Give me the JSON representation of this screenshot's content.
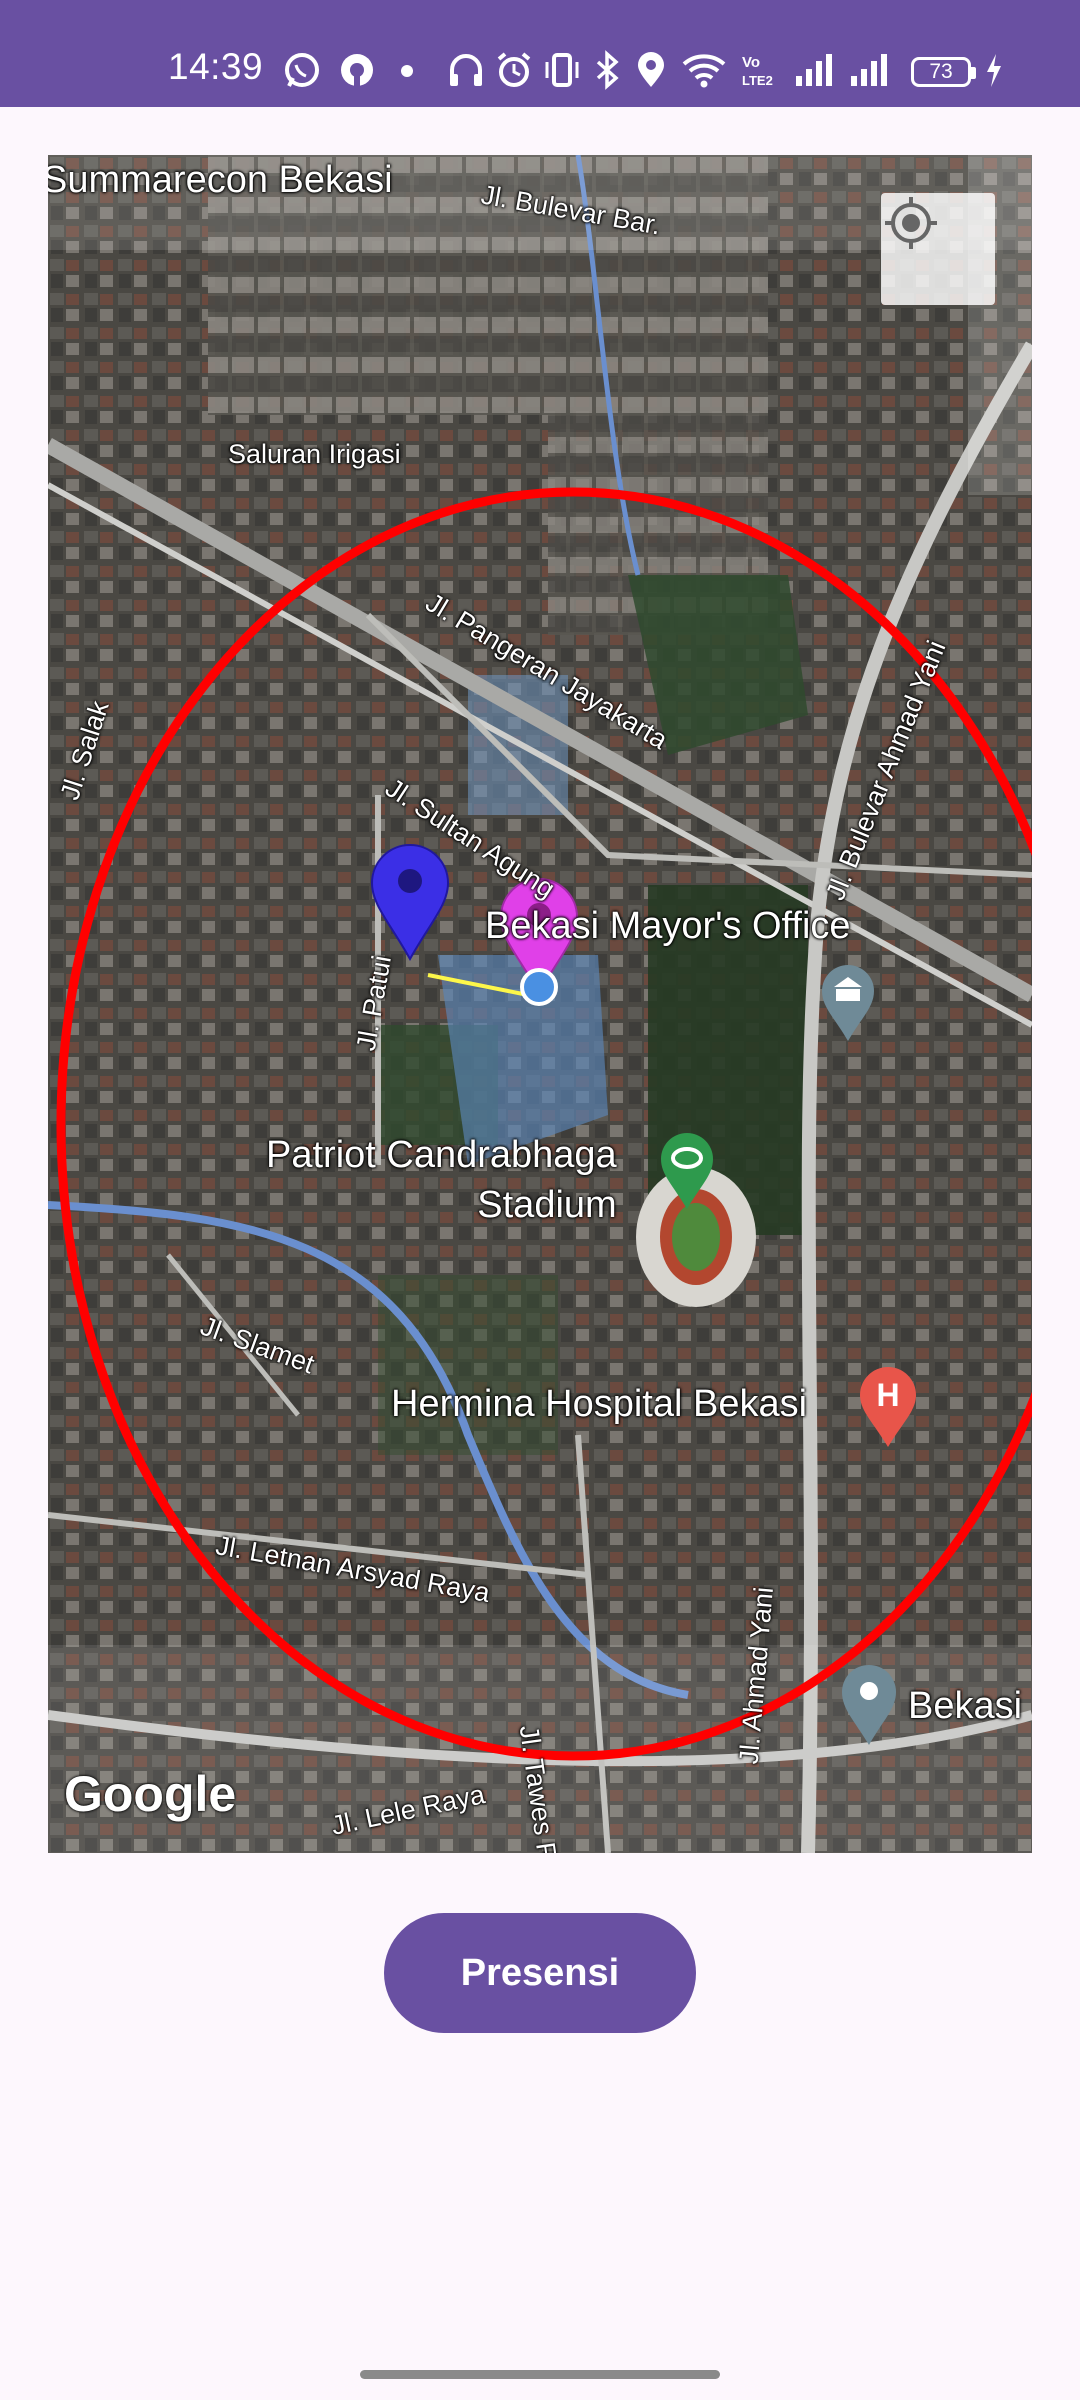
{
  "status_bar": {
    "time": "14:39",
    "battery": "73",
    "icons": [
      "whatsapp-icon",
      "app-icon",
      "dot-icon",
      "headphones-icon",
      "alarm-icon",
      "vibrate-icon",
      "bluetooth-icon",
      "location-icon",
      "wifi-icon",
      "volte-icon",
      "signal-icon",
      "signal-icon",
      "battery-icon",
      "charging-icon"
    ],
    "volte_text": "Vo\nLTE2"
  },
  "map": {
    "labels": {
      "summarecon": "Summarecon Bekasi",
      "bulevar_barat": "Jl. Bulevar Bar.",
      "saluran": "Saluran Irigasi",
      "pangeran": "Jl. Pangeran Jayakarta",
      "salak": "Jl. Salak",
      "sultan": "Jl. Sultan Agung",
      "bulevar_yani": "Jl. Bulevar Ahmad Yani",
      "patui": "Jl. Patui",
      "mayor": "Bekasi Mayor's Office",
      "stadium": "Patriot Candrabhaga\nStadium",
      "slamet": "Jl. Slamet",
      "hermina": "Hermina Hospital Bekasi",
      "letnan": "Jl. Letnan Arsyad Raya",
      "tawes": "Jl. Tawes Raya",
      "ahmad_yani": "Jl. Ahmad Yani",
      "bekasi": "Bekasi",
      "lele": "Jl. Lele Raya"
    },
    "google": "Google",
    "circle_color": "#ff0000",
    "marker_user_color": "#3b2fe6",
    "marker_office_color": "#e040e8",
    "dot_color": "#4a90e2"
  },
  "presensi_label": "Presensi"
}
